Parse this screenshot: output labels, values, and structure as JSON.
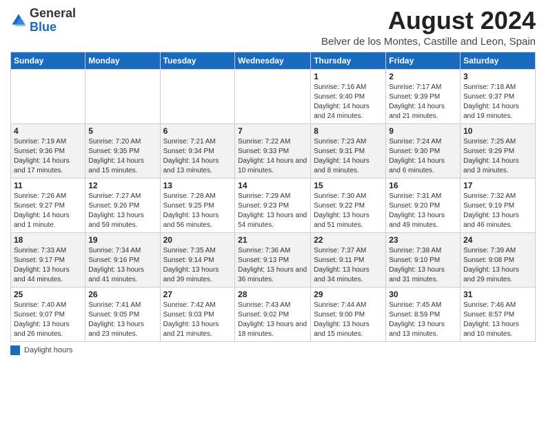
{
  "header": {
    "logo_general": "General",
    "logo_blue": "Blue",
    "month_year": "August 2024",
    "location": "Belver de los Montes, Castille and Leon, Spain"
  },
  "days_of_week": [
    "Sunday",
    "Monday",
    "Tuesday",
    "Wednesday",
    "Thursday",
    "Friday",
    "Saturday"
  ],
  "weeks": [
    [
      {
        "day": "",
        "info": ""
      },
      {
        "day": "",
        "info": ""
      },
      {
        "day": "",
        "info": ""
      },
      {
        "day": "",
        "info": ""
      },
      {
        "day": "1",
        "info": "Sunrise: 7:16 AM\nSunset: 9:40 PM\nDaylight: 14 hours and 24 minutes."
      },
      {
        "day": "2",
        "info": "Sunrise: 7:17 AM\nSunset: 9:39 PM\nDaylight: 14 hours and 21 minutes."
      },
      {
        "day": "3",
        "info": "Sunrise: 7:18 AM\nSunset: 9:37 PM\nDaylight: 14 hours and 19 minutes."
      }
    ],
    [
      {
        "day": "4",
        "info": "Sunrise: 7:19 AM\nSunset: 9:36 PM\nDaylight: 14 hours and 17 minutes."
      },
      {
        "day": "5",
        "info": "Sunrise: 7:20 AM\nSunset: 9:35 PM\nDaylight: 14 hours and 15 minutes."
      },
      {
        "day": "6",
        "info": "Sunrise: 7:21 AM\nSunset: 9:34 PM\nDaylight: 14 hours and 13 minutes."
      },
      {
        "day": "7",
        "info": "Sunrise: 7:22 AM\nSunset: 9:33 PM\nDaylight: 14 hours and 10 minutes."
      },
      {
        "day": "8",
        "info": "Sunrise: 7:23 AM\nSunset: 9:31 PM\nDaylight: 14 hours and 8 minutes."
      },
      {
        "day": "9",
        "info": "Sunrise: 7:24 AM\nSunset: 9:30 PM\nDaylight: 14 hours and 6 minutes."
      },
      {
        "day": "10",
        "info": "Sunrise: 7:25 AM\nSunset: 9:29 PM\nDaylight: 14 hours and 3 minutes."
      }
    ],
    [
      {
        "day": "11",
        "info": "Sunrise: 7:26 AM\nSunset: 9:27 PM\nDaylight: 14 hours and 1 minute."
      },
      {
        "day": "12",
        "info": "Sunrise: 7:27 AM\nSunset: 9:26 PM\nDaylight: 13 hours and 59 minutes."
      },
      {
        "day": "13",
        "info": "Sunrise: 7:28 AM\nSunset: 9:25 PM\nDaylight: 13 hours and 56 minutes."
      },
      {
        "day": "14",
        "info": "Sunrise: 7:29 AM\nSunset: 9:23 PM\nDaylight: 13 hours and 54 minutes."
      },
      {
        "day": "15",
        "info": "Sunrise: 7:30 AM\nSunset: 9:22 PM\nDaylight: 13 hours and 51 minutes."
      },
      {
        "day": "16",
        "info": "Sunrise: 7:31 AM\nSunset: 9:20 PM\nDaylight: 13 hours and 49 minutes."
      },
      {
        "day": "17",
        "info": "Sunrise: 7:32 AM\nSunset: 9:19 PM\nDaylight: 13 hours and 46 minutes."
      }
    ],
    [
      {
        "day": "18",
        "info": "Sunrise: 7:33 AM\nSunset: 9:17 PM\nDaylight: 13 hours and 44 minutes."
      },
      {
        "day": "19",
        "info": "Sunrise: 7:34 AM\nSunset: 9:16 PM\nDaylight: 13 hours and 41 minutes."
      },
      {
        "day": "20",
        "info": "Sunrise: 7:35 AM\nSunset: 9:14 PM\nDaylight: 13 hours and 39 minutes."
      },
      {
        "day": "21",
        "info": "Sunrise: 7:36 AM\nSunset: 9:13 PM\nDaylight: 13 hours and 36 minutes."
      },
      {
        "day": "22",
        "info": "Sunrise: 7:37 AM\nSunset: 9:11 PM\nDaylight: 13 hours and 34 minutes."
      },
      {
        "day": "23",
        "info": "Sunrise: 7:38 AM\nSunset: 9:10 PM\nDaylight: 13 hours and 31 minutes."
      },
      {
        "day": "24",
        "info": "Sunrise: 7:39 AM\nSunset: 9:08 PM\nDaylight: 13 hours and 29 minutes."
      }
    ],
    [
      {
        "day": "25",
        "info": "Sunrise: 7:40 AM\nSunset: 9:07 PM\nDaylight: 13 hours and 26 minutes."
      },
      {
        "day": "26",
        "info": "Sunrise: 7:41 AM\nSunset: 9:05 PM\nDaylight: 13 hours and 23 minutes."
      },
      {
        "day": "27",
        "info": "Sunrise: 7:42 AM\nSunset: 9:03 PM\nDaylight: 13 hours and 21 minutes."
      },
      {
        "day": "28",
        "info": "Sunrise: 7:43 AM\nSunset: 9:02 PM\nDaylight: 13 hours and 18 minutes."
      },
      {
        "day": "29",
        "info": "Sunrise: 7:44 AM\nSunset: 9:00 PM\nDaylight: 13 hours and 15 minutes."
      },
      {
        "day": "30",
        "info": "Sunrise: 7:45 AM\nSunset: 8:59 PM\nDaylight: 13 hours and 13 minutes."
      },
      {
        "day": "31",
        "info": "Sunrise: 7:46 AM\nSunset: 8:57 PM\nDaylight: 13 hours and 10 minutes."
      }
    ]
  ],
  "footer": {
    "daylight_hours_label": "Daylight hours"
  }
}
